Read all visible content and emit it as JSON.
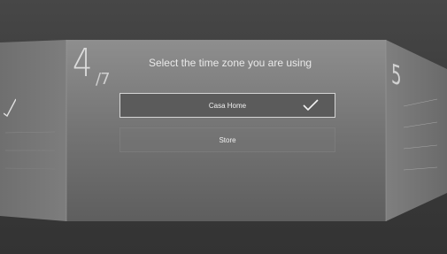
{
  "setup": {
    "step": {
      "current": "4",
      "total": "/7"
    },
    "title": "Select the time zone you are using",
    "options": [
      {
        "label": "Casa Home",
        "selected": true
      },
      {
        "label": "Store",
        "selected": false
      }
    ]
  },
  "next_panel": {
    "step_number": "5"
  },
  "colors": {
    "background": "#3a3a3a",
    "panel_light": "#7a7a7a",
    "selection_border": "#d6d6d6",
    "text": "#f0f0f0"
  },
  "icons": {
    "selected_option": "checkmark-icon"
  }
}
